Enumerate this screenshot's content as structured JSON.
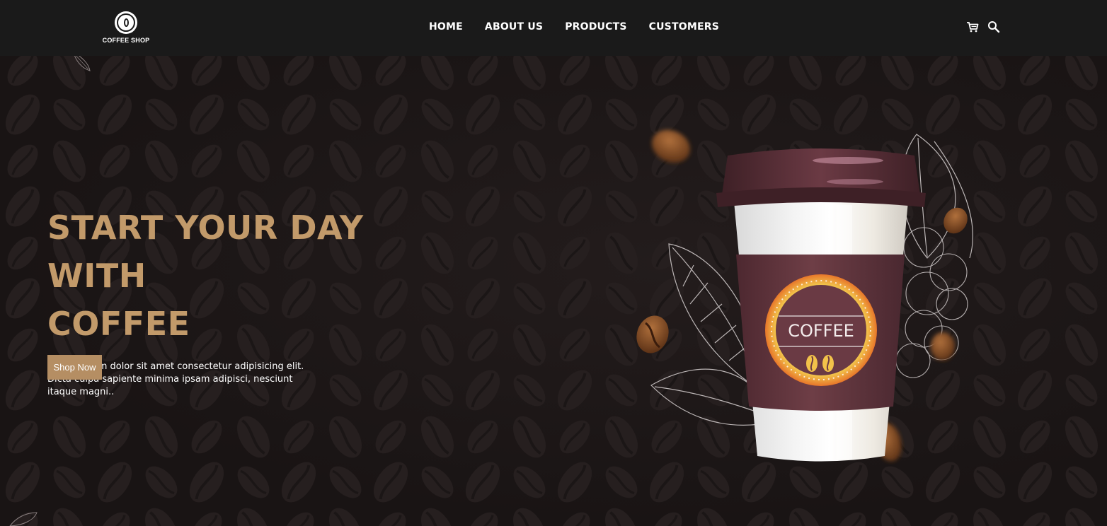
{
  "brand": {
    "name": "COFFEE SHOP",
    "accent_color": "#c29a6a",
    "button_color": "#b58e63",
    "background_color": "#1b1616",
    "nav_background": "#1a1a1a"
  },
  "nav": {
    "links": [
      "HOME",
      "ABOUT US",
      "PRODUCTS",
      "CUSTOMERS"
    ],
    "icons": [
      "cart-icon",
      "search-icon"
    ]
  },
  "hero": {
    "title_line1": "START YOUR DAY WITH",
    "title_line2": "COFFEE",
    "description": "Lorem ipsum dolor sit amet consectetur adipisicing elit. Dicta culpa sapiente minima ipsam adipisci, nesciunt itaque magni..",
    "cta_label": "Shop Now"
  },
  "product_image": {
    "cup_label": "COFFEE",
    "icon": "coffee-cup-illustration"
  }
}
